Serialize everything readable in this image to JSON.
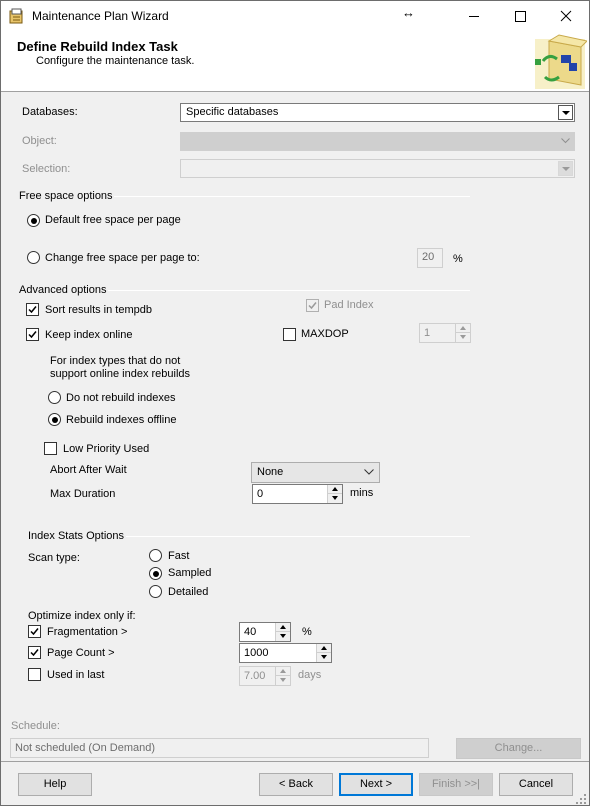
{
  "window": {
    "title": "Maintenance Plan Wizard",
    "resize_glyph": "↔",
    "minimize_glyph": "—",
    "maximize_glyph": "☐",
    "close_glyph": "✕"
  },
  "header": {
    "title": "Define Rebuild Index Task",
    "subtitle": "Configure the maintenance task."
  },
  "fields": {
    "databases_label": "Databases:",
    "databases_value": "Specific databases",
    "object_label": "Object:",
    "object_value": "",
    "selection_label": "Selection:",
    "selection_value": ""
  },
  "free_space": {
    "group_label": "Free space options",
    "default_label": "Default free space per page",
    "change_label": "Change free space per page to:",
    "change_value": "20",
    "unit": "%"
  },
  "advanced": {
    "group_label": "Advanced options",
    "sort_label": "Sort results in tempdb",
    "pad_label": "Pad Index",
    "keep_online_label": "Keep index online",
    "maxdop_label": "MAXDOP",
    "maxdop_value": "1",
    "online_note_line1": "For index types that do not",
    "online_note_line2": "support online index rebuilds",
    "do_not_rebuild_label": "Do not rebuild indexes",
    "rebuild_offline_label": "Rebuild indexes offline",
    "low_priority_label": "Low Priority Used",
    "abort_label": "Abort After Wait",
    "abort_value": "None",
    "max_duration_label": "Max Duration",
    "max_duration_value": "0",
    "max_duration_unit": "mins"
  },
  "stats": {
    "group_label": "Index Stats Options",
    "scan_label": "Scan type:",
    "fast_label": "Fast",
    "sampled_label": "Sampled",
    "detailed_label": "Detailed",
    "optimize_label": "Optimize index only if:",
    "frag_label": "Fragmentation >",
    "frag_value": "40",
    "frag_unit": "%",
    "page_count_label": "Page Count >",
    "page_count_value": "1000",
    "used_label": "Used  in last",
    "used_value": "7.00",
    "used_unit": "days"
  },
  "schedule": {
    "label": "Schedule:",
    "value": "Not scheduled (On Demand)",
    "change_button": "Change..."
  },
  "footer": {
    "help": "Help",
    "back": "< Back",
    "next": "Next >",
    "finish": "Finish >>|",
    "cancel": "Cancel"
  },
  "state": {
    "sort_in_tempdb": true,
    "pad_index": true,
    "keep_index_online": true,
    "maxdop": false,
    "low_priority_used": false,
    "fragmentation": true,
    "page_count": true,
    "used_in_last": false,
    "free_space_choice": "default",
    "online_choice": "rebuild_offline",
    "scan_type": "sampled"
  },
  "colors": {
    "window_bg": "#f0f0f0",
    "accent": "#0078d7",
    "disabled_text": "#8f8f8f"
  }
}
